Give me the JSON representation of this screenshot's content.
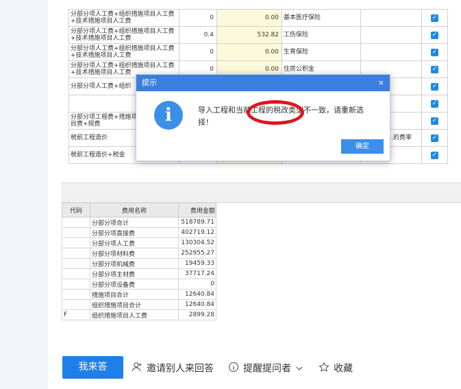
{
  "top_rows": [
    {
      "name": "分部分项人工费+组织措施项目人工费+技术措施项目人工费",
      "num": "0",
      "amount": "0.00",
      "label": "基本医疗保险",
      "rate": ""
    },
    {
      "name": "分部分项人工费+组织措施项目人工费+技术措施项目人工费",
      "num": "0.4",
      "amount": "532.82",
      "label": "工伤保险",
      "rate": ""
    },
    {
      "name": "分部分项人工费+组织措施项目人工费+技术措施项目人工费",
      "num": "0",
      "amount": "0.00",
      "label": "生育保险",
      "rate": ""
    },
    {
      "name": "分部分项人工费+组织措施项目人工费+技术措施项目人工费",
      "num": "0",
      "amount": "0.00",
      "label": "住房公积金",
      "rate": ""
    },
    {
      "name": "分部分项人工费+组织",
      "num": "",
      "amount": "",
      "label": "",
      "rate": ""
    },
    {
      "name": "",
      "num": "",
      "amount": "",
      "label": "",
      "rate": ""
    },
    {
      "name": "分部分项工程费+措施项目费+其他项目费+规费",
      "num": "",
      "amount": "",
      "label": "",
      "rate": ""
    },
    {
      "name": "税前工程造价",
      "num": "",
      "amount": "",
      "label": "",
      "rate": "…日前工…的费率"
    },
    {
      "name": "税前工程造价+税金",
      "num": "",
      "amount": "",
      "label": "",
      "rate": ""
    }
  ],
  "bottom_table": {
    "headers": [
      "代码",
      "费用名称",
      "费用金额"
    ],
    "rows": [
      {
        "code": "",
        "name": "分部分项合计",
        "amount": "518789.71"
      },
      {
        "code": "",
        "name": "分部分项直接费",
        "amount": "402719.12"
      },
      {
        "code": "",
        "name": "分部分项人工费",
        "amount": "130304.52"
      },
      {
        "code": "",
        "name": "分部分项材料费",
        "amount": "252955.27"
      },
      {
        "code": "",
        "name": "分部分项机械费",
        "amount": "19459.33"
      },
      {
        "code": "",
        "name": "分部分项主材费",
        "amount": "37717.24"
      },
      {
        "code": "",
        "name": "分部分项设备费",
        "amount": "0"
      },
      {
        "code": "",
        "name": "措施项目合计",
        "amount": "12640.84"
      },
      {
        "code": "",
        "name": "组织措施项目合计",
        "amount": "12640.84"
      },
      {
        "code": "F",
        "name": "组织措施项目人工费",
        "amount": "2899.28"
      }
    ]
  },
  "dialog": {
    "title": "提示",
    "close": "×",
    "icon": "info-icon",
    "message": "导入工程和当前工程的税改类型不一致，请重新选择！",
    "ok": "确定"
  },
  "actions": {
    "answer": "我来答",
    "invite": "邀请别人来回答",
    "remind": "提醒提问者",
    "favorite": "收藏"
  },
  "colors": {
    "accent": "#1e7fe8",
    "highlight": "#e0141d"
  }
}
